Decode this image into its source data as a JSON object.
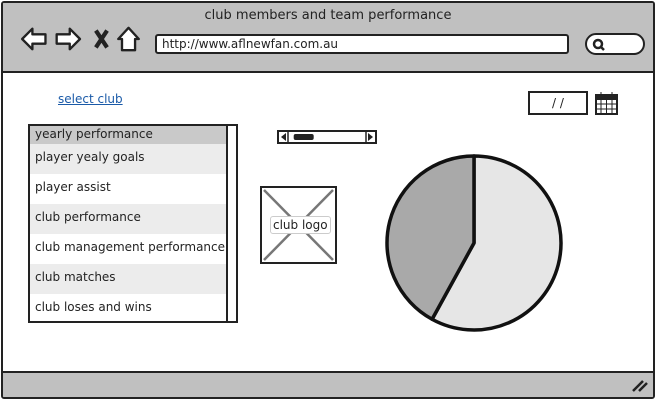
{
  "window": {
    "title": "club members and team performance"
  },
  "browser": {
    "url": "http://www.aflnewfan.com.au",
    "icons": [
      "back-arrow-icon",
      "forward-arrow-icon",
      "stop-icon",
      "home-icon",
      "search-icon"
    ]
  },
  "page": {
    "select_club_link": "select club",
    "date_field": " / /",
    "list": {
      "header": "yearly performance",
      "items": [
        "player yealy goals",
        "player assist",
        "club performance",
        "club management performance",
        "club matches",
        "club loses and wins"
      ]
    },
    "scrollbar_position": 0.05,
    "logo_label": "club logo",
    "pie": {
      "slices": [
        {
          "value": 58,
          "color": "#e6e6e6"
        },
        {
          "value": 42,
          "color": "#a9a9a9"
        }
      ]
    }
  }
}
